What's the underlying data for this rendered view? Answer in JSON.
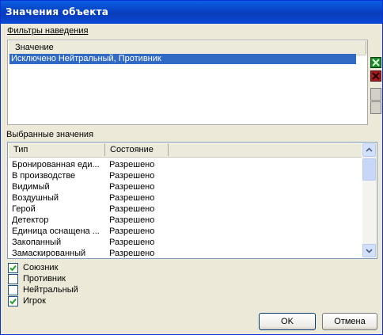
{
  "window": {
    "title": "Значения объекта"
  },
  "filters": {
    "heading": "Фильтры наведения",
    "column_header": "Значение",
    "rows": [
      "Исключено Нейтральный, Противник"
    ],
    "side_buttons": [
      "add-icon",
      "remove-icon"
    ]
  },
  "selected": {
    "heading": "Выбранные значения",
    "columns": [
      "Тип",
      "Состояние"
    ],
    "rows": [
      {
        "type": "Бронированная еди...",
        "state": "Разрешено"
      },
      {
        "type": "В производстве",
        "state": "Разрешено"
      },
      {
        "type": "Видимый",
        "state": "Разрешено"
      },
      {
        "type": "Воздушный",
        "state": "Разрешено"
      },
      {
        "type": "Герой",
        "state": "Разрешено"
      },
      {
        "type": "Детектор",
        "state": "Разрешено"
      },
      {
        "type": "Единица оснащена ...",
        "state": "Разрешено"
      },
      {
        "type": "Закопанный",
        "state": "Разрешено"
      },
      {
        "type": "Замаскированный",
        "state": "Разрешено"
      }
    ]
  },
  "checkboxes": [
    {
      "label": "Союзник",
      "checked": true
    },
    {
      "label": "Противник",
      "checked": false
    },
    {
      "label": "Нейтральный",
      "checked": false
    },
    {
      "label": "Игрок",
      "checked": true
    }
  ],
  "buttons": {
    "ok": "OK",
    "cancel": "Отмена"
  },
  "colors": {
    "title_bar": "#0a3cb8",
    "selection": "#316ac5",
    "dialog_bg": "#ece9d8"
  }
}
